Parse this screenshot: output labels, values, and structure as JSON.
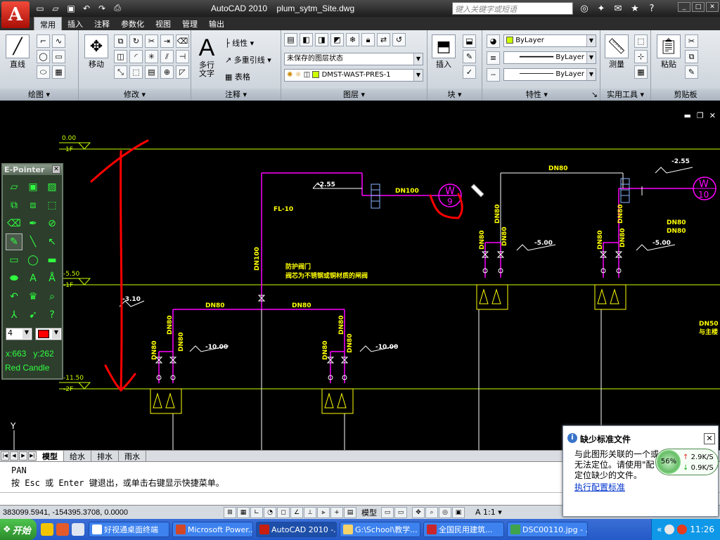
{
  "window": {
    "app_name": "AutoCAD 2010",
    "file_name": "plum_sytm_Site.dwg",
    "search_placeholder": "键入关键字或短语"
  },
  "ribbon_tabs": [
    "常用",
    "插入",
    "注释",
    "参数化",
    "视图",
    "管理",
    "输出"
  ],
  "panels": {
    "draw": {
      "title": "绘图",
      "line": "直线"
    },
    "modify": {
      "title": "修改",
      "move": "移动"
    },
    "annotation": {
      "title": "注释",
      "mtext": "多行文字",
      "linetype": "线性",
      "mleader": "多重引线",
      "table": "表格"
    },
    "layers": {
      "title": "图层",
      "state": "未保存的图层状态",
      "current": "DMST-WAST-PRES-1"
    },
    "block": {
      "title": "块",
      "insert": "插入"
    },
    "properties": {
      "title": "特性",
      "color": "ByLayer",
      "lineweight": "ByLayer",
      "linetype": "ByLayer"
    },
    "utilities": {
      "title": "实用工具",
      "measure": "测量"
    },
    "clipboard": {
      "title": "剪贴板",
      "paste": "粘贴"
    }
  },
  "drawing": {
    "levels": [
      {
        "elev": "0.00",
        "floor": "1F"
      },
      {
        "elev": "-5.50",
        "floor": "-1F"
      },
      {
        "elev": "-11.50",
        "floor": "-2F"
      }
    ],
    "labels": {
      "fl": "FL-10",
      "dn100_v": "DN100",
      "dn100_h": "DN100",
      "dn80_a": "DN80",
      "dn80_b": "DN80",
      "dn80_c": "DN80",
      "dn80_v1": "DN80",
      "dn80_v2": "DN80",
      "dn80_v3": "DN80",
      "dn80_v4": "DN80",
      "dn80_v5": "DN80",
      "dn80_v6": "DN80",
      "dn80_v7": "DN80",
      "dn80_v8": "DN80",
      "dn80_v9": "DN80",
      "dn80_v10": "DN80",
      "dn80_v11": "DN80",
      "dn80_v12": "DN80",
      "dn80_r1": "DN80",
      "dn80_r2": "DN80",
      "e255a": "-2.55",
      "e255b": "-2.55",
      "e310": "-3.10",
      "e500a": "-5.00",
      "e500b": "-5.00",
      "e1000a": "-10.00",
      "e1000b": "-10.00",
      "note1": "防护阀门",
      "note2": "阀芯为不锈钢或铜材质的闸阀",
      "w9_letter": "W",
      "w9_num": "9",
      "w10_letter": "W",
      "w10_num": "10",
      "dn50": "DN50",
      "dn50b": "与主楼",
      "ucs_y": "Y"
    }
  },
  "epointer": {
    "title": "E-Pointer",
    "size": "4",
    "pen_color": "#ff0000",
    "x": "x:663",
    "y": "y:262",
    "pen_name": "Red Candle"
  },
  "layout_tabs": [
    "模型",
    "给水",
    "排水",
    "雨水"
  ],
  "command": {
    "line1": "PAN",
    "line2": "按 Esc 或 Enter 键退出，或单击右键显示快捷菜单。"
  },
  "status": {
    "coords": "383099.5941, -154395.3708, 0.0000",
    "model": "模型",
    "scale": "1:1"
  },
  "notification": {
    "title": "缺少标准文件",
    "body": "与此图形关联的一个或\n无法定位。请使用\"配\n定位缺少的文件。",
    "link": "执行配置标准"
  },
  "netmon": {
    "pct": "56%",
    "up": "2.9K/S",
    "down": "0.9K/S"
  },
  "taskbar": {
    "start": "开始",
    "tasks": [
      "好视通桌面终端",
      "Microsoft Power...",
      "AutoCAD 2010 -...",
      "G:\\School\\教学...",
      "全国民用建筑...",
      "DSC00110.jpg - ..."
    ],
    "time": "11:26"
  },
  "colors": {
    "pipe": "#ff00ff",
    "level": "#c8ff00",
    "annotation": "#ffff00",
    "red_ink": "#ff0000"
  }
}
